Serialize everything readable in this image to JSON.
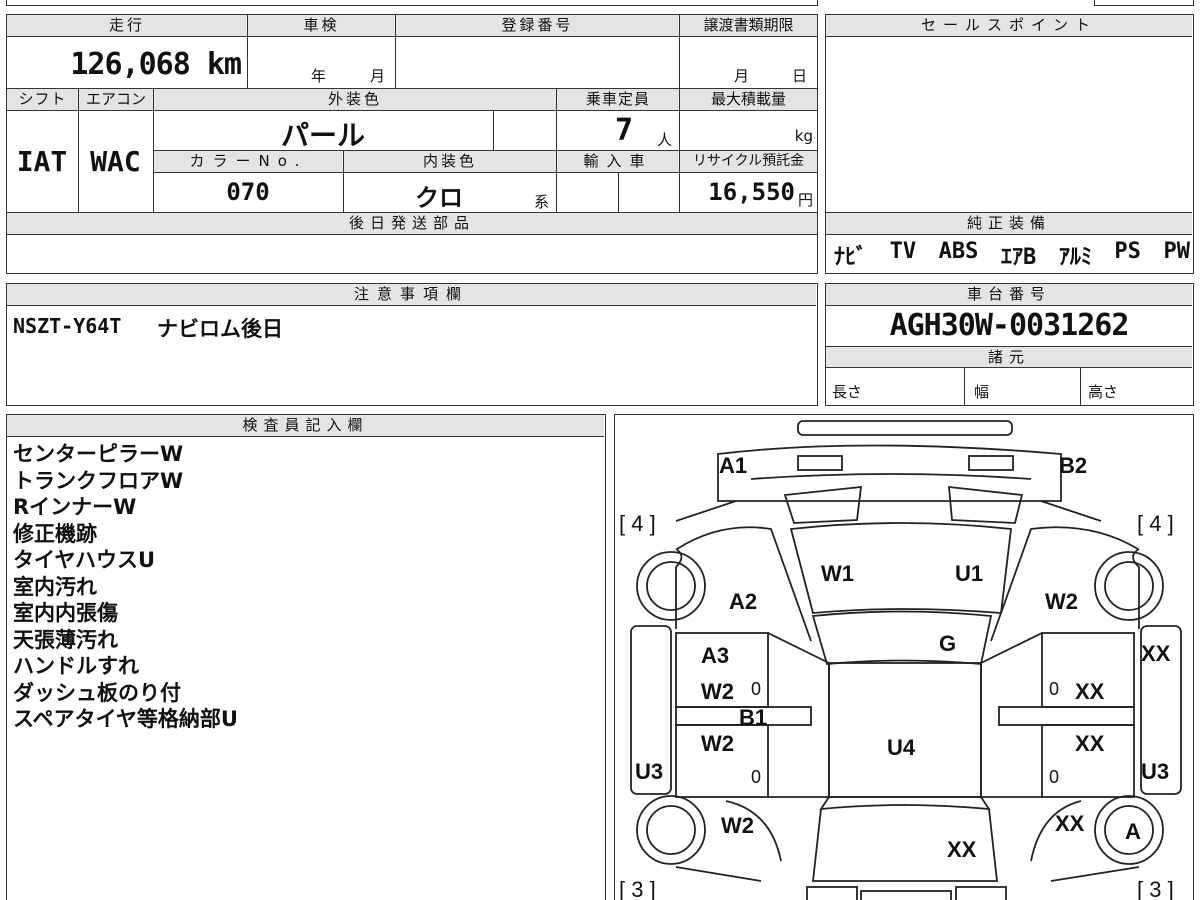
{
  "vehicle": {
    "mileage_label": "走行",
    "mileage_value": "126,068 km",
    "inspection_label": "車検",
    "inspection_year": "年",
    "inspection_month": "月",
    "registration_label": "登録番号",
    "transfer_deadline_label": "譲渡書類期限",
    "transfer_month": "月",
    "transfer_day": "日",
    "shift_label": "シフト",
    "shift_value": "IAT",
    "ac_label": "エアコン",
    "ac_value": "WAC",
    "exterior_color_label": "外装色",
    "exterior_color_value": "パール",
    "capacity_label": "乗車定員",
    "capacity_value": "7",
    "capacity_unit": "人",
    "max_load_label": "最大積載量",
    "max_load_unit": "kg",
    "color_no_label": "カラーNo.",
    "color_no_value": "070",
    "interior_color_label": "内装色",
    "interior_color_value": "クロ",
    "interior_color_suffix": "系",
    "import_label": "輸入車",
    "recycle_label": "リサイクル預託金",
    "recycle_value": "16,550",
    "recycle_unit": "円",
    "later_parts_label": "後日発送部品"
  },
  "sales_point": {
    "label": "セールスポイント"
  },
  "equipment": {
    "label": "純正装備",
    "items": [
      "ﾅﾋﾞ",
      "TV",
      "ABS",
      "ｴｱB",
      "ｱﾙﾐ",
      "PS",
      "PW"
    ]
  },
  "notes": {
    "label": "注意事項欄",
    "code": "NSZT-Y64T",
    "text": "ナビロム後日"
  },
  "chassis": {
    "label": "車台番号",
    "value": "AGH30W-0031262",
    "spec_label": "諸元",
    "length_label": "長さ",
    "width_label": "幅",
    "height_label": "高さ"
  },
  "inspector": {
    "label": "検査員記入欄",
    "lines": [
      "センターピラーW",
      "トランクフロアW",
      "RインナーW",
      "修正機跡",
      "タイヤハウスU",
      "室内汚れ",
      "室内内張傷",
      "天張薄汚れ",
      "ハンドルすれ",
      "ダッシュ板のり付",
      "スペアタイヤ等格納部U"
    ]
  },
  "diagram": {
    "tire_front_left": "[ 4 ]",
    "tire_front_right": "[ 4 ]",
    "tire_rear_left": "[ 3 ]",
    "tire_rear_right": "[ 3 ]",
    "marks": {
      "a1": "A1",
      "b2": "B2",
      "w1": "W1",
      "u1": "U1",
      "a2": "A2",
      "w2_right_front": "W2",
      "g": "G",
      "a3": "A3",
      "w2_l1": "W2",
      "b1": "B1",
      "w2_l2": "W2",
      "u4": "U4",
      "u3_left": "U3",
      "u3_right": "U3",
      "xx_r1": "XX",
      "xx_r2": "XX",
      "xx_r3": "XX",
      "xx_r4": "XX",
      "xx_bottom": "XX",
      "w2_bottom": "W2",
      "a_wheel": "A",
      "zero_1": "0",
      "zero_2": "0",
      "zero_3": "0",
      "zero_4": "0"
    }
  }
}
